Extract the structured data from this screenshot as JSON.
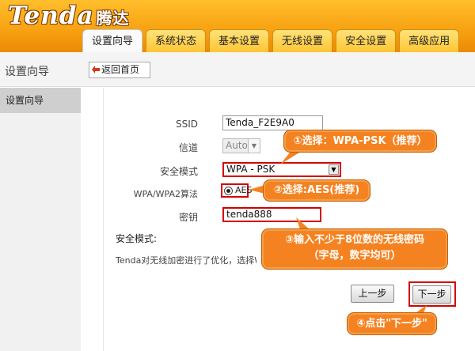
{
  "brand": {
    "logo": "Tenda",
    "logo_sub": "腾达"
  },
  "tabs": [
    {
      "label": "设置向导",
      "active": true
    },
    {
      "label": "系统状态",
      "active": false
    },
    {
      "label": "基本设置",
      "active": false
    },
    {
      "label": "无线设置",
      "active": false
    },
    {
      "label": "安全设置",
      "active": false
    },
    {
      "label": "高级应用",
      "active": false
    }
  ],
  "subbar": {
    "title": "设置向导",
    "home_button": "返回首页"
  },
  "sidebar": {
    "items": [
      {
        "label": "设置向导",
        "selected": true
      }
    ]
  },
  "form": {
    "ssid_label": "SSID",
    "ssid_value": "Tenda_F2E9A0",
    "channel_label": "信道",
    "channel_value": "Auto",
    "mode_label": "安全模式",
    "mode_value": "WPA - PSK",
    "cipher_label": "WPA/WPA2算法",
    "cipher_value": "AES",
    "key_label": "密钥",
    "key_value": "tenda888",
    "security_heading": "安全模式:",
    "security_desc": "Tenda对无线加密进行了优化，选择WPA"
  },
  "buttons": {
    "prev": "上一步",
    "next": "下一步"
  },
  "callouts": {
    "step1": "①选择：WPA-PSK（推荐）",
    "step2": "②选择:AES(推荐)",
    "step3_line1": "③输入不少于8位数的无线密码",
    "step3_line2": "（字母，数字均可）",
    "step4": "④点击\"下一步\""
  },
  "colors": {
    "header": "#f8a313",
    "highlight": "#d40000",
    "callout": "#f58220"
  }
}
